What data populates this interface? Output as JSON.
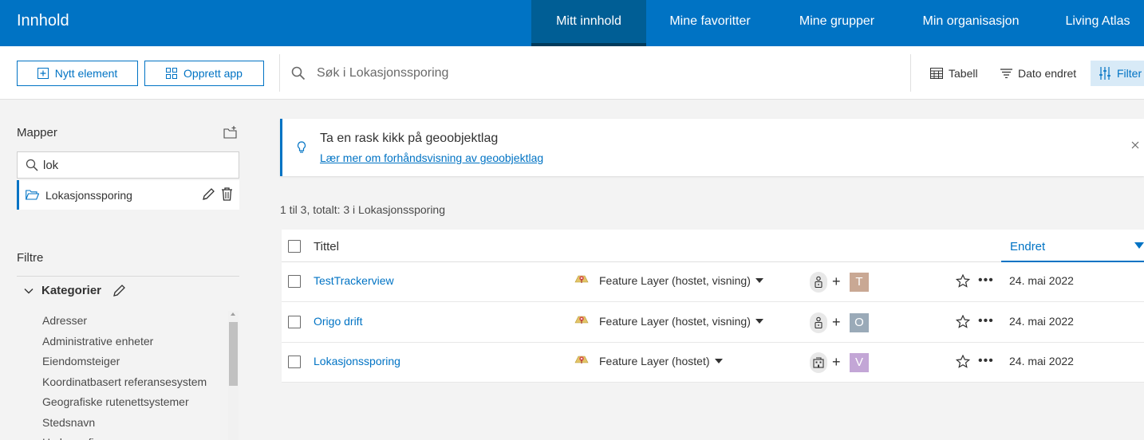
{
  "header": {
    "title": "Innhold",
    "tabs": [
      {
        "label": "Mitt innhold",
        "active": true
      },
      {
        "label": "Mine favoritter"
      },
      {
        "label": "Mine grupper"
      },
      {
        "label": "Min organisasjon"
      },
      {
        "label": "Living Atlas"
      }
    ],
    "accent_color": "#0073c4",
    "active_tab_color": "#005e95"
  },
  "toolbar": {
    "new_item_label": "Nytt element",
    "create_app_label": "Opprett app",
    "search_placeholder": "Søk i Lokasjonssporing",
    "table_view_label": "Tabell",
    "sort_label": "Dato endret",
    "filter_label": "Filter"
  },
  "sidebar": {
    "folders_heading": "Mapper",
    "folder_search_value": "lok",
    "folders": [
      {
        "name": "Lokasjonssporing",
        "selected": true
      }
    ],
    "filters_heading": "Filtre",
    "categories_heading": "Kategorier",
    "categories": [
      "Adresser",
      "Administrative enheter",
      "Eiendomsteiger",
      "Koordinatbasert referansesystem",
      "Geografiske rutenettsystemer",
      "Stedsnavn",
      "Hydrografi"
    ]
  },
  "banner": {
    "title": "Ta en rask kikk på geoobjektlag",
    "link": "Lær mer om forhåndsvisning av geoobjektlag"
  },
  "results": {
    "count_text": "1 til 3, totalt: 3 i Lokasjonssporing"
  },
  "table": {
    "col_title": "Tittel",
    "col_changed": "Endret",
    "rows": [
      {
        "title": "TestTrackerview",
        "type": "Feature Layer (hostet, visning)",
        "sharing_icon": "lock-person-icon",
        "avatar_letter": "T",
        "avatar_color": "#c9a894",
        "changed": "24. mai 2022"
      },
      {
        "title": "Origo drift",
        "type": "Feature Layer (hostet, visning)",
        "sharing_icon": "lock-person-icon",
        "avatar_letter": "O",
        "avatar_color": "#9aaab8",
        "changed": "24. mai 2022"
      },
      {
        "title": "Lokasjonssporing",
        "type": "Feature Layer (hostet)",
        "sharing_icon": "organization-icon",
        "avatar_letter": "V",
        "avatar_color": "#c3a6d6",
        "changed": "24. mai 2022"
      }
    ]
  }
}
